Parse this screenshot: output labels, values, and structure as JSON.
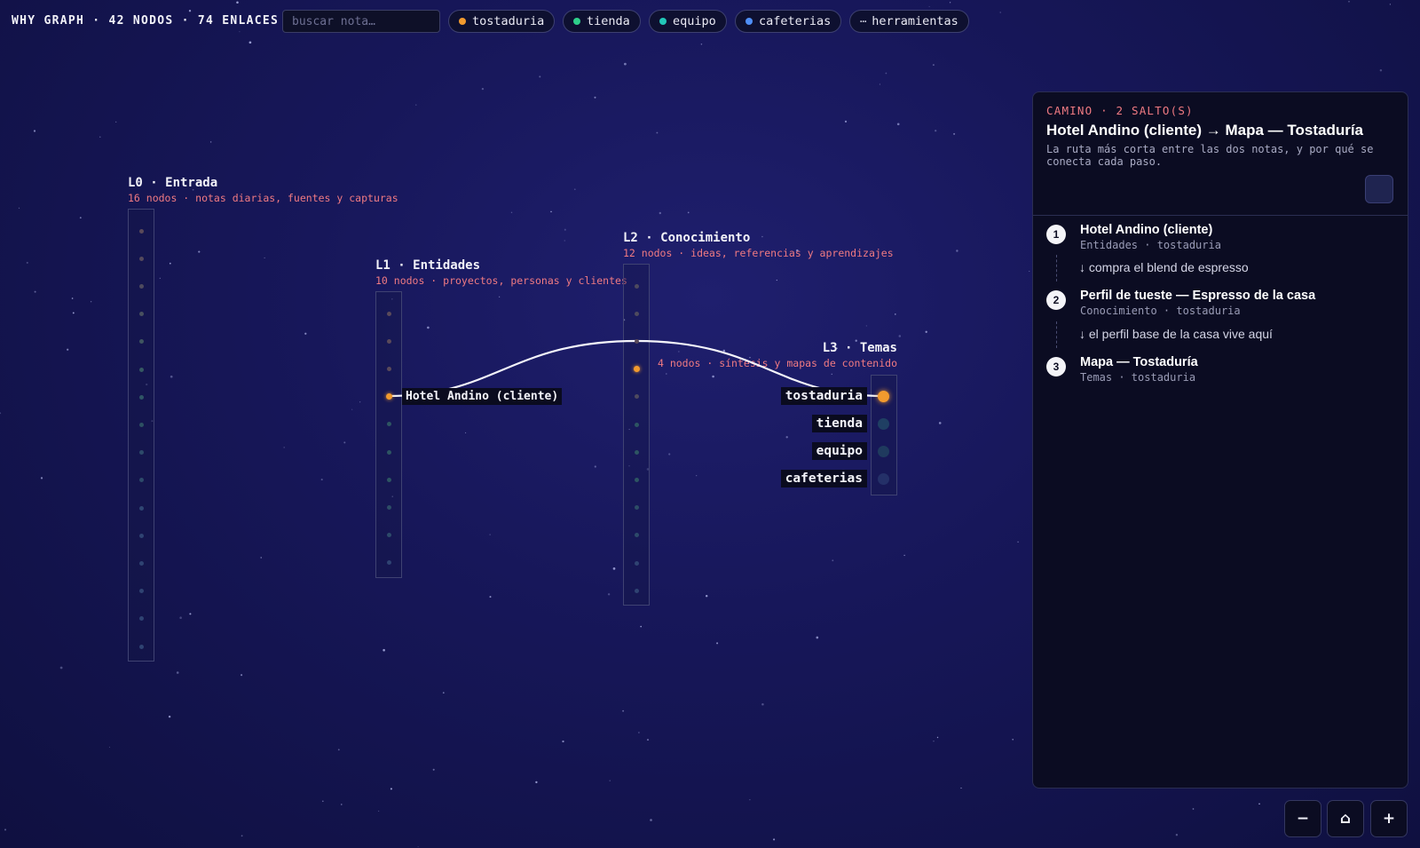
{
  "header": {
    "brand": "WHY GRAPH · 42 NODOS · 74 ENLACES",
    "search_placeholder": "buscar nota…",
    "filters": [
      {
        "label": "tostaduria",
        "color": "#f29a2e"
      },
      {
        "label": "tienda",
        "color": "#2ecf8a"
      },
      {
        "label": "equipo",
        "color": "#22c7b8"
      },
      {
        "label": "cafeterias",
        "color": "#4f8ff7"
      },
      {
        "label": "herramientas",
        "icon": "ellipsis-icon"
      }
    ]
  },
  "layers": [
    {
      "title": "L0 · Entrada",
      "subtitle": "16 nodos · notas diarias, fuentes y capturas"
    },
    {
      "title": "L1 · Entidades",
      "subtitle": "10 nodos · proyectos, personas y clientes"
    },
    {
      "title": "L2 · Conocimiento",
      "subtitle": "12 nodos · ideas, referencias y aprendizajes"
    },
    {
      "title": "L3 · Temas",
      "subtitle": "4 nodos · síntesis y mapas de contenido"
    }
  ],
  "graph": {
    "highlighted_node": "Hotel Andino (cliente)",
    "topics": [
      "tostaduria",
      "tienda",
      "equipo",
      "cafeterias"
    ],
    "colors": {
      "path": "#f29a2e",
      "edge": "#f4f4fa",
      "accent": "#f07a82"
    }
  },
  "panel": {
    "kicker": "CAMINO · 2 SALTO(S)",
    "title": "Hotel Andino (cliente) → Mapa — Tostaduría",
    "description": "La ruta más corta entre las dos notas, y por qué se conecta cada paso.",
    "steps": [
      {
        "num": "1",
        "title": "Hotel Andino (cliente)",
        "meta": "Entidades · tostaduria",
        "reason": "↓ compra el blend de espresso"
      },
      {
        "num": "2",
        "title": "Perfil de tueste — Espresso de la casa",
        "meta": "Conocimiento · tostaduria",
        "reason": "↓ el perfil base de la casa vive aquí"
      },
      {
        "num": "3",
        "title": "Mapa — Tostaduría",
        "meta": "Temas · tostaduria"
      }
    ]
  },
  "zoom": {
    "out": "−",
    "home": "⌂",
    "in": "+"
  }
}
